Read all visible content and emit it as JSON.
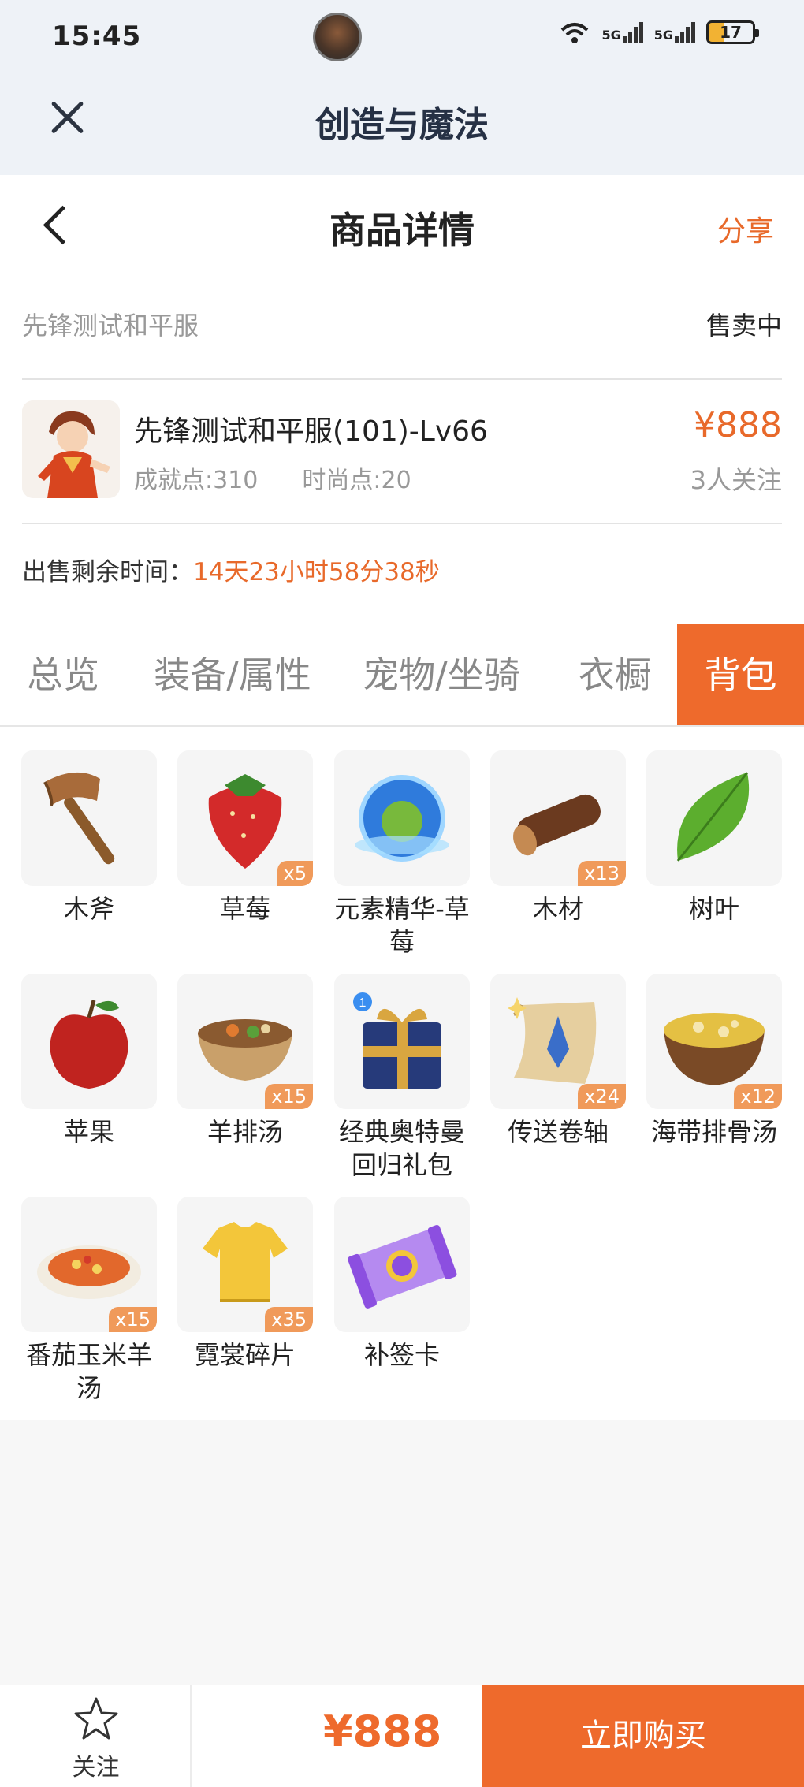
{
  "status_bar": {
    "time": "15:45",
    "battery": "17",
    "signal_1": "5G",
    "signal_2": "5G",
    "wifi_badge": "6"
  },
  "app_header": {
    "title": "创造与魔法"
  },
  "page_nav": {
    "title": "商品详情",
    "share": "分享"
  },
  "listing": {
    "seller": "先锋测试和平服",
    "status": "售卖中",
    "character_name": "先锋测试和平服(101)-Lv66",
    "achievement": "成就点:310",
    "fashion": "时尚点:20",
    "price": "¥888",
    "followers": "3人关注",
    "time_label": "出售剩余时间：",
    "time_value": "14天23小时58分38秒"
  },
  "tabs": [
    {
      "label": "总览",
      "active": false
    },
    {
      "label": "装备/属性",
      "active": false
    },
    {
      "label": "宠物/坐骑",
      "active": false
    },
    {
      "label": "衣橱",
      "active": false
    },
    {
      "label": "背包",
      "active": true
    }
  ],
  "inventory": [
    {
      "name": "木斧",
      "qty": ""
    },
    {
      "name": "草莓",
      "qty": "x5"
    },
    {
      "name": "元素精华-草莓",
      "qty": ""
    },
    {
      "name": "木材",
      "qty": "x13"
    },
    {
      "name": "树叶",
      "qty": ""
    },
    {
      "name": "苹果",
      "qty": ""
    },
    {
      "name": "羊排汤",
      "qty": "x15"
    },
    {
      "name": "经典奥特曼回归礼包",
      "qty": ""
    },
    {
      "name": "传送卷轴",
      "qty": "x24"
    },
    {
      "name": "海带排骨汤",
      "qty": "x12"
    },
    {
      "name": "番茄玉米羊汤",
      "qty": "x15"
    },
    {
      "name": "霓裳碎片",
      "qty": "x35"
    },
    {
      "name": "补签卡",
      "qty": ""
    }
  ],
  "bottom_bar": {
    "follow": "关注",
    "price": "¥888",
    "buy": "立即购买"
  },
  "colors": {
    "accent": "#ee6a2c",
    "header_bg": "#eef2f7"
  }
}
